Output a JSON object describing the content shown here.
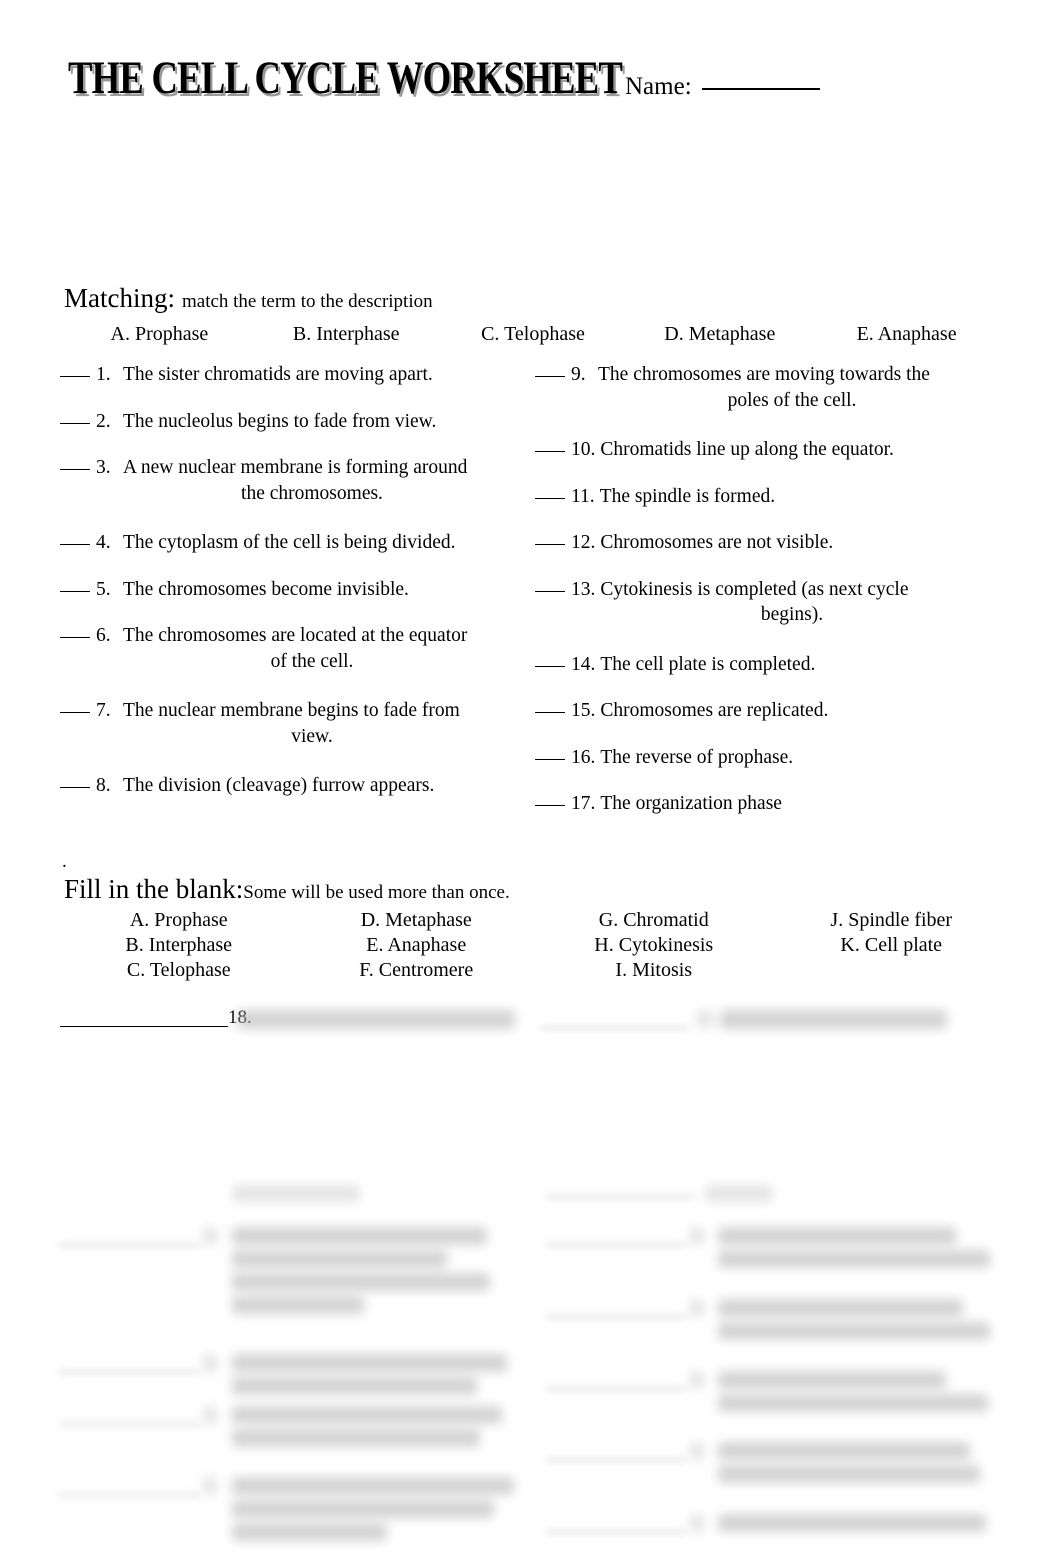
{
  "page": {
    "title": "THE CELL CYCLE WORKSHEET",
    "name_label": "Name:"
  },
  "matching": {
    "heading": "Matching:",
    "instruction": "match the term to the description",
    "options": [
      "A. Prophase",
      "B. Interphase",
      "C. Telophase",
      "D. Metaphase",
      "E. Anaphase"
    ],
    "left_items": [
      {
        "num": "1.",
        "text": "The sister chromatids are moving apart.",
        "cont": ""
      },
      {
        "num": "2.",
        "text": "The nucleolus begins to fade from view.",
        "cont": ""
      },
      {
        "num": "3.",
        "text": "A new nuclear membrane is forming around",
        "cont": "the chromosomes."
      },
      {
        "num": "4.",
        "text": "The cytoplasm of the cell is being divided.",
        "cont": ""
      },
      {
        "num": "5.",
        "text": "The chromosomes become invisible.",
        "cont": ""
      },
      {
        "num": "6.",
        "text": "The chromosomes are located at the equator",
        "cont": "of the cell."
      },
      {
        "num": "7.",
        "text": "The nuclear membrane begins to fade from",
        "cont": "view."
      },
      {
        "num": "8.",
        "text": "The division (cleavage) furrow appears.",
        "cont": ""
      }
    ],
    "right_items": [
      {
        "num": "9.",
        "text": "The chromosomes are moving towards the",
        "cont": "poles of the cell."
      },
      {
        "num": "10.",
        "text": "Chromatids line up along the equator.",
        "cont": ""
      },
      {
        "num": "11.",
        "text": "The spindle is formed.",
        "cont": ""
      },
      {
        "num": "12.",
        "text": "Chromosomes are not visible.",
        "cont": ""
      },
      {
        "num": "13.",
        "text": "Cytokinesis is completed (as next cycle",
        "cont": "begins)."
      },
      {
        "num": "14.",
        "text": "The cell plate is completed.",
        "cont": ""
      },
      {
        "num": "15.",
        "text": "Chromosomes are replicated.",
        "cont": ""
      },
      {
        "num": "16.",
        "text": "The reverse of prophase.",
        "cont": ""
      },
      {
        "num": "17.",
        "text": "The organization phase",
        "cont": ""
      }
    ]
  },
  "fill_in_blank": {
    "stray_mark": ".",
    "heading": "Fill in the blank:",
    "instruction": "Some will be used more than once.",
    "bank_rows": [
      [
        "A. Prophase",
        "D. Metaphase",
        "G.  Chromatid",
        "J. Spindle fiber"
      ],
      [
        "B. Interphase",
        "E. Anaphase",
        "H. Cytokinesis",
        "K. Cell plate"
      ],
      [
        "C. Telophase",
        "F. Centromere",
        "I. Mitosis",
        ""
      ]
    ],
    "first_item_number": "18."
  }
}
